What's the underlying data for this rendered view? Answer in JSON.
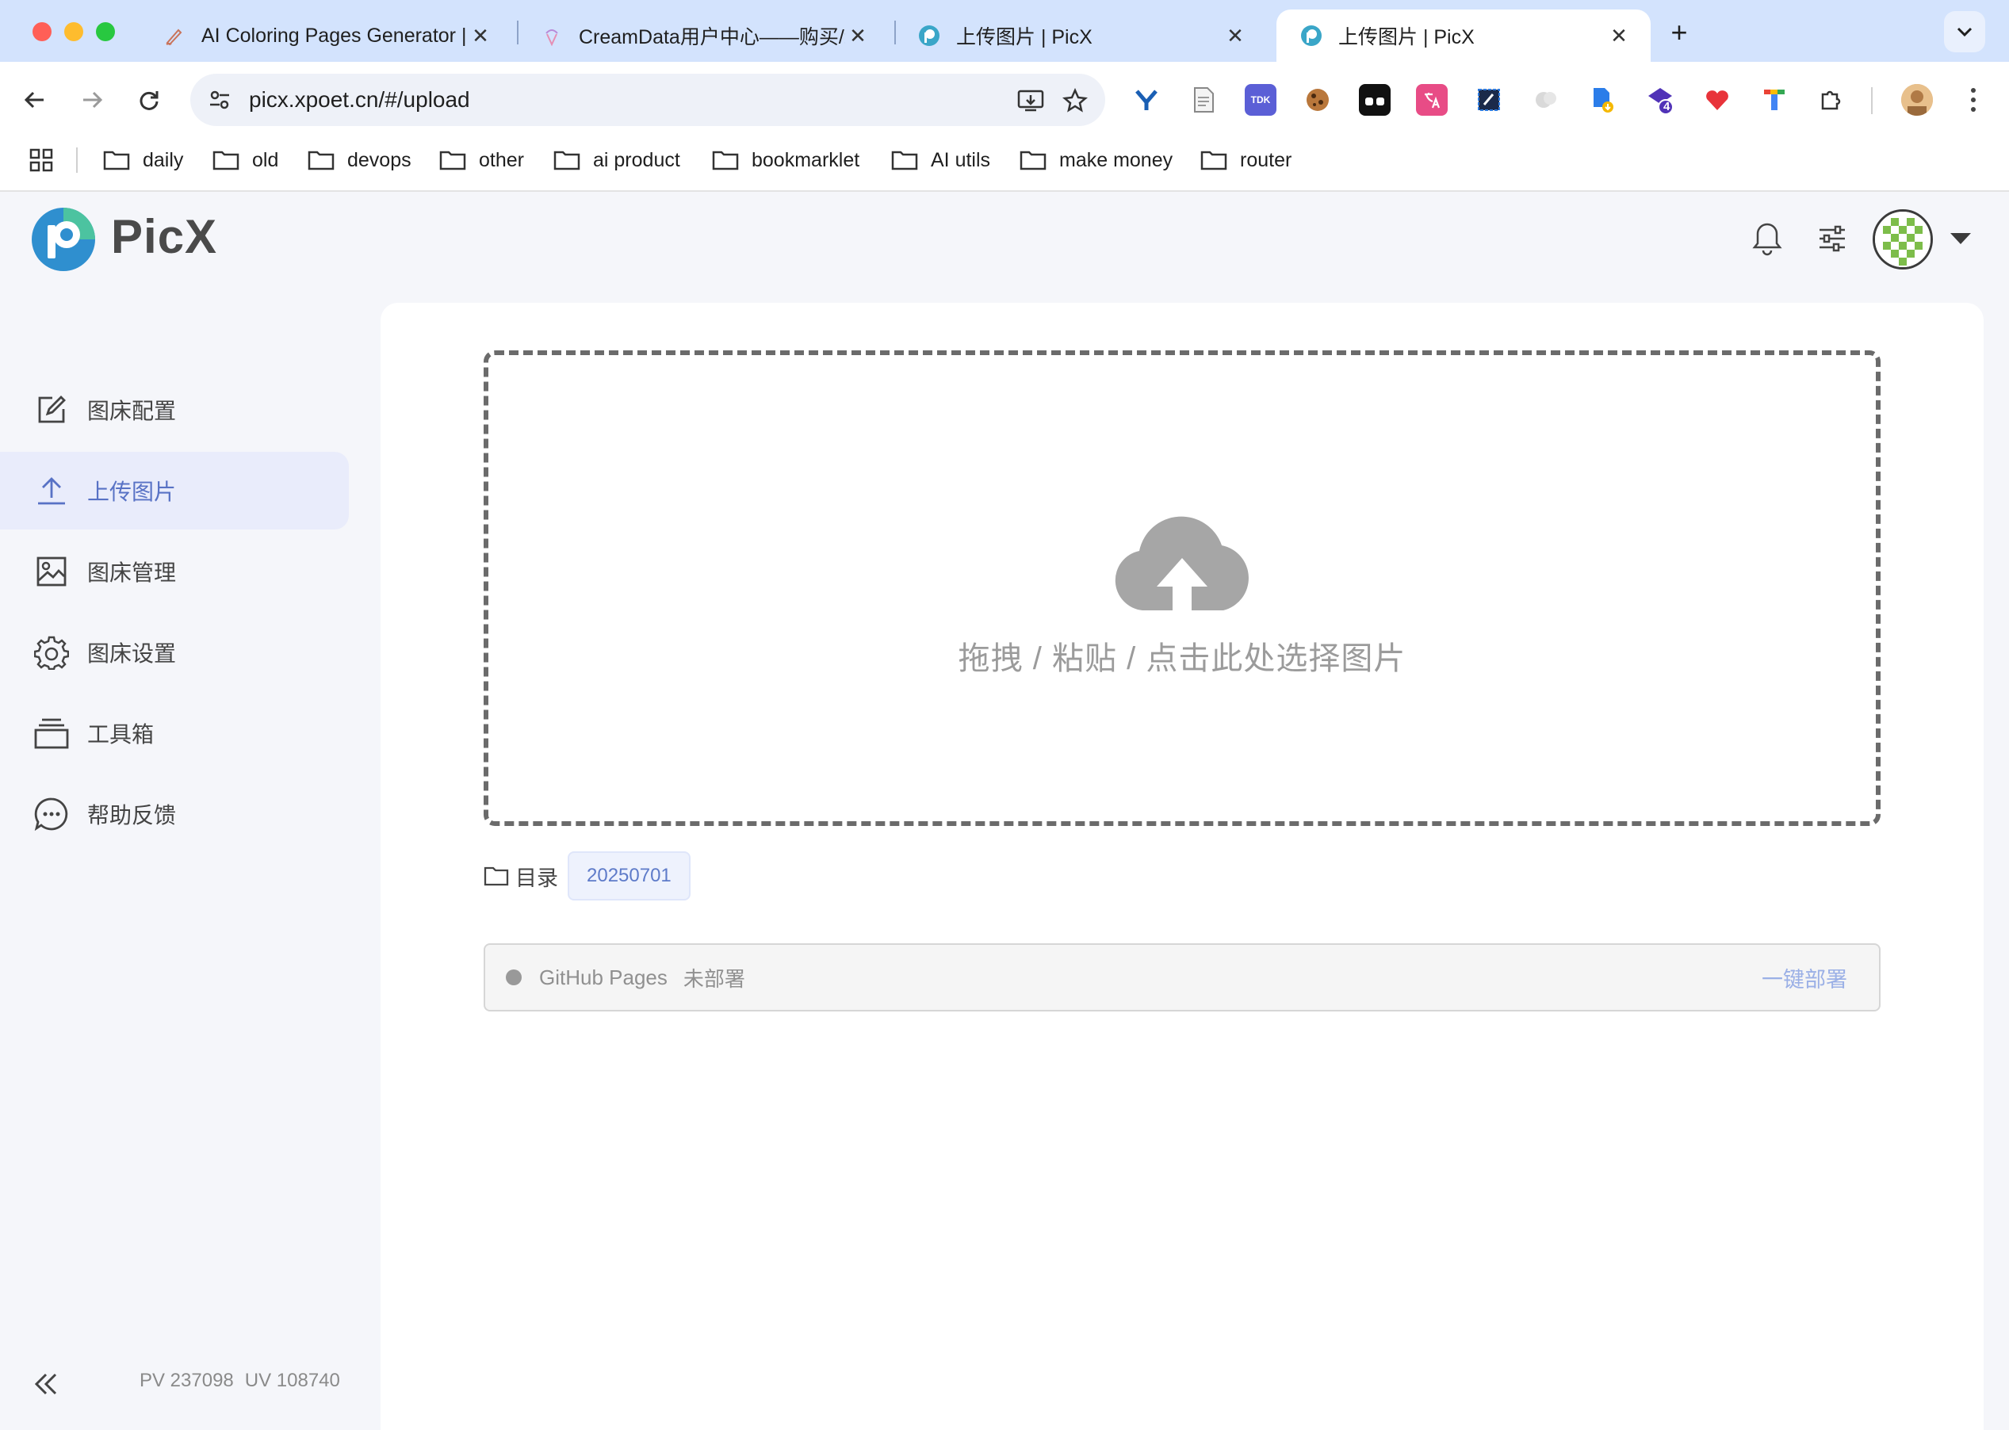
{
  "browser": {
    "tabs": [
      {
        "title": "AI Coloring Pages Generator |",
        "icon": "pen-icon",
        "active": false
      },
      {
        "title": "CreamData用户中心——购买/续",
        "icon": "creamdata-icon",
        "active": false
      },
      {
        "title": "上传图片 | PicX",
        "icon": "picx-icon",
        "active": false
      },
      {
        "title": "上传图片 | PicX",
        "icon": "picx-icon",
        "active": true
      }
    ],
    "close_glyph": "✕",
    "new_tab_glyph": "+",
    "url": "picx.xpoet.cn/#/upload",
    "extension_badge": "4",
    "ext_tdk_label": "TDK",
    "bookmarks": [
      "daily",
      "old",
      "devops",
      "other",
      "ai product",
      "bookmarklet",
      "AI utils",
      "make money",
      "router"
    ]
  },
  "app": {
    "brand": "PicX",
    "nav": [
      {
        "label": "图床配置",
        "icon": "edit-icon",
        "active": false
      },
      {
        "label": "上传图片",
        "icon": "upload-icon",
        "active": true
      },
      {
        "label": "图床管理",
        "icon": "image-icon",
        "active": false
      },
      {
        "label": "图床设置",
        "icon": "gear-icon",
        "active": false
      },
      {
        "label": "工具箱",
        "icon": "toolbox-icon",
        "active": false
      },
      {
        "label": "帮助反馈",
        "icon": "chat-icon",
        "active": false
      }
    ],
    "stats": {
      "pv": "PV 237098",
      "uv": "UV 108740"
    },
    "upload": {
      "drop_text": "拖拽 / 粘贴 / 点击此处选择图片",
      "dir_label": "目录",
      "dir_value": "20250701"
    },
    "deploy": {
      "name": "GitHub Pages",
      "status": "未部署",
      "action": "一键部署"
    },
    "colors": {
      "accent": "#5872c5",
      "active_bg": "#e9ecfb",
      "tab_strip": "#d3e3fd"
    }
  }
}
